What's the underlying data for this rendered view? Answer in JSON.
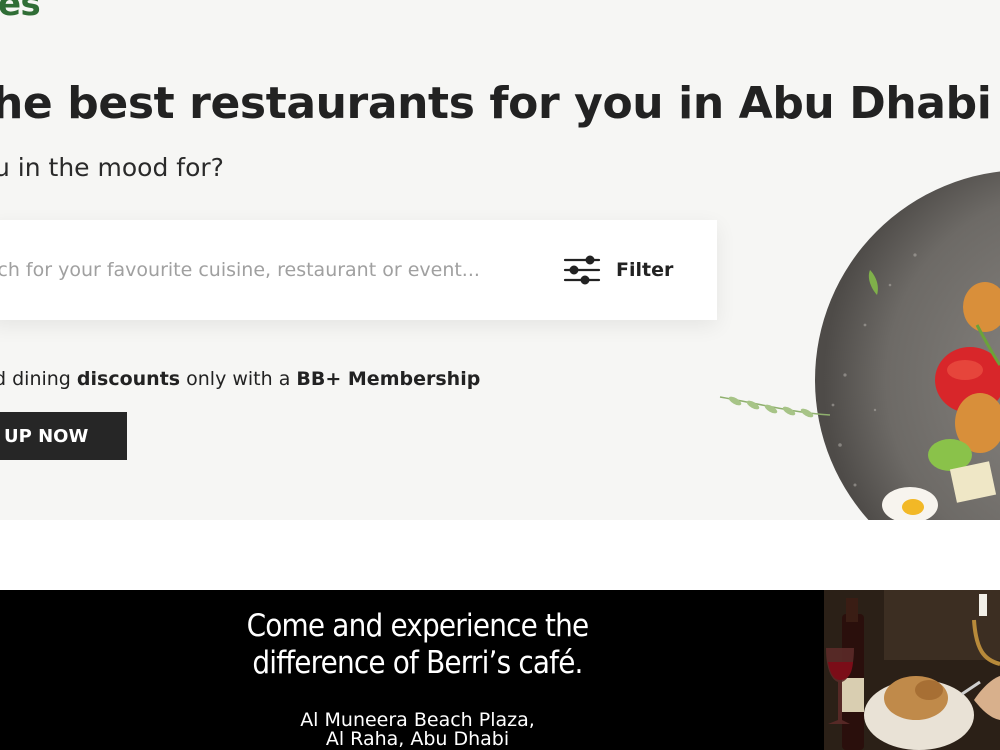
{
  "brand": {
    "logo_fragment": "es"
  },
  "hero": {
    "headline": "he best restaurants for you in Abu Dhabi",
    "subheadline": "u in the mood for?"
  },
  "search": {
    "placeholder": "rch for your favourite cuisine, restaurant or event...",
    "value": "",
    "filter_label": "Filter",
    "filter_icon": "sliders-icon"
  },
  "promo": {
    "prefix": "d dining ",
    "discounts": "discounts",
    "middle": " only with a ",
    "membership": "BB+ Membership",
    "signup_label": "UP NOW"
  },
  "ad": {
    "headline_line1": "Come and experience the",
    "headline_line2": "difference of Berri’s café.",
    "address_line1": "Al Muneera Beach Plaza,",
    "address_line2": "Al Raha, Abu Dhabi"
  },
  "colors": {
    "brand_green": "#2f6d35",
    "hero_background": "#f6f6f4",
    "button_dark": "#262626",
    "ad_background": "#000000"
  }
}
